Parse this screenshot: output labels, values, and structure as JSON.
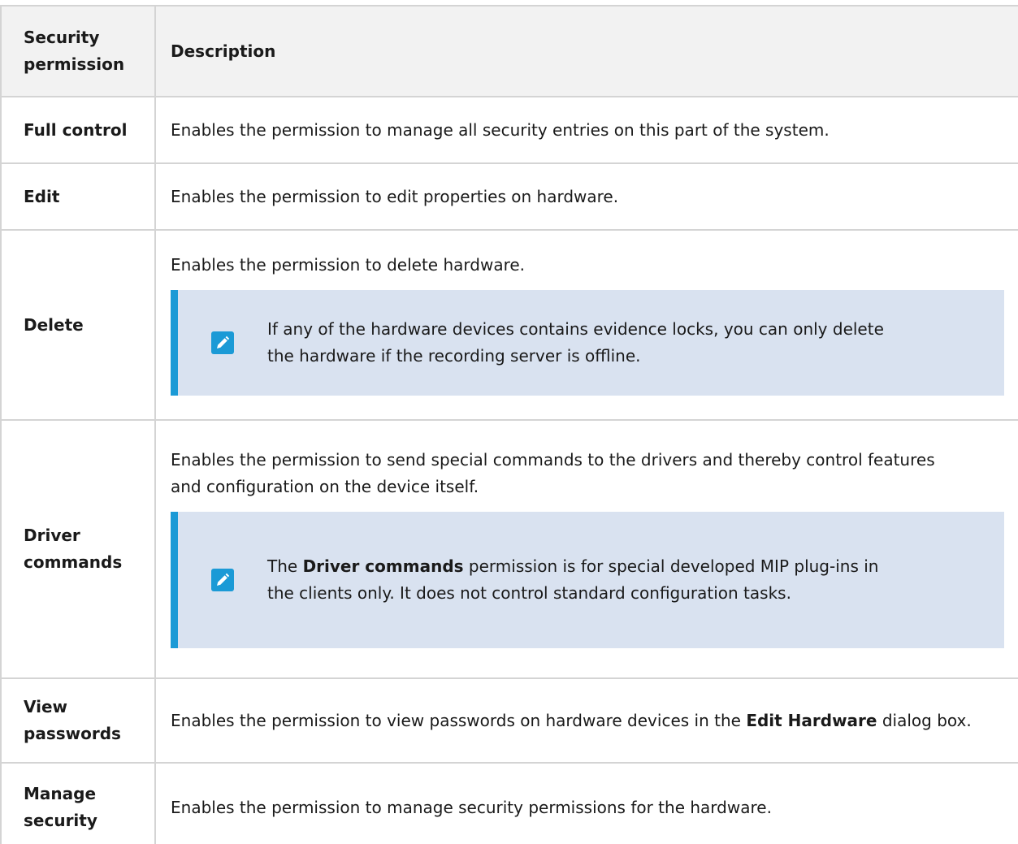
{
  "headers": {
    "permission": "Security permission",
    "description": "Description"
  },
  "rows": [
    {
      "permission": "Full control",
      "description": "Enables the permission to manage all security entries on this part of the system."
    },
    {
      "permission": "Edit",
      "description": "Enables the permission to edit properties on hardware."
    },
    {
      "permission": "Delete",
      "description": "Enables the permission to delete hardware.",
      "note": {
        "icon": "pencil-icon",
        "text": "If any of the hardware devices contains evidence locks, you can only delete the hardware if the recording server is offline."
      }
    },
    {
      "permission": "Driver commands",
      "description": "Enables the permission to send special commands to the drivers and thereby control features and configuration on the device itself.",
      "note": {
        "icon": "pencil-icon",
        "prefix": "The",
        "bold": "Driver commands",
        "suffix": "permission is for special developed MIP plug-ins in the clients only. It does not control standard configuration tasks."
      }
    },
    {
      "permission": "View passwords",
      "description_prefix": "Enables the permission to view passwords on hardware devices in the",
      "description_bold": "Edit Hardware",
      "description_suffix": "dialog box."
    },
    {
      "permission": "Manage security",
      "description": "Enables the permission to manage security permissions for the hardware."
    }
  ],
  "colors": {
    "note_background": "#d9e2f0",
    "note_accent": "#1b9ad6",
    "header_background": "#f2f2f2",
    "border": "#d4d4d4"
  }
}
